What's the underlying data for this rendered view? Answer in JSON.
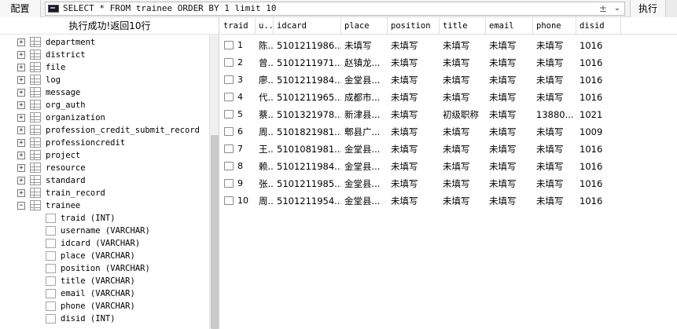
{
  "toolbar": {
    "config_label": "配置",
    "sql": "SELECT * FROM trainee ORDER BY 1 limit 10",
    "plus_minus": "±",
    "dropdown_glyph": "⌄",
    "execute_label": "执行"
  },
  "left_panel": {
    "status": "执行成功!返回10行",
    "tables": [
      {
        "name": "department",
        "expander": "+"
      },
      {
        "name": "district",
        "expander": "+"
      },
      {
        "name": "file",
        "expander": "+"
      },
      {
        "name": "log",
        "expander": "+"
      },
      {
        "name": "message",
        "expander": "+"
      },
      {
        "name": "org_auth",
        "expander": "+"
      },
      {
        "name": "organization",
        "expander": "+"
      },
      {
        "name": "profession_credit_submit_record",
        "expander": "+"
      },
      {
        "name": "professioncredit",
        "expander": "+"
      },
      {
        "name": "project",
        "expander": "+"
      },
      {
        "name": "resource",
        "expander": "+"
      },
      {
        "name": "standard",
        "expander": "+"
      },
      {
        "name": "train_record",
        "expander": "+"
      },
      {
        "name": "trainee",
        "expander": "−"
      }
    ],
    "columns": [
      "traid (INT)",
      "username (VARCHAR)",
      "idcard (VARCHAR)",
      "place (VARCHAR)",
      "position (VARCHAR)",
      "title (VARCHAR)",
      "email (VARCHAR)",
      "phone (VARCHAR)",
      "disid (INT)"
    ]
  },
  "grid": {
    "headers": [
      "traid",
      "u..",
      "idcard",
      "place",
      "position",
      "title",
      "email",
      "phone",
      "disid"
    ],
    "rows": [
      [
        "1",
        "陈..",
        "5101211986...",
        "未填写",
        "未填写",
        "未填写",
        "未填写",
        "未填写",
        "1016"
      ],
      [
        "2",
        "曾..",
        "5101211971...",
        "赵镇龙...",
        "未填写",
        "未填写",
        "未填写",
        "未填写",
        "1016"
      ],
      [
        "3",
        "廖..",
        "5101211984...",
        "金堂县...",
        "未填写",
        "未填写",
        "未填写",
        "未填写",
        "1016"
      ],
      [
        "4",
        "代..",
        "5101211965...",
        "成都市...",
        "未填写",
        "未填写",
        "未填写",
        "未填写",
        "1016"
      ],
      [
        "5",
        "蔡..",
        "5101321978...",
        "新津县...",
        "未填写",
        "初级职称",
        "未填写",
        "13880...",
        "1021"
      ],
      [
        "6",
        "周..",
        "5101821981...",
        "郫县广...",
        "未填写",
        "未填写",
        "未填写",
        "未填写",
        "1009"
      ],
      [
        "7",
        "王..",
        "5101081981...",
        "金堂县...",
        "未填写",
        "未填写",
        "未填写",
        "未填写",
        "1016"
      ],
      [
        "8",
        "赖..",
        "5101211984...",
        "金堂县...",
        "未填写",
        "未填写",
        "未填写",
        "未填写",
        "1016"
      ],
      [
        "9",
        "张..",
        "5101211985...",
        "金堂县...",
        "未填写",
        "未填写",
        "未填写",
        "未填写",
        "1016"
      ],
      [
        "10",
        "周..",
        "5101211954...",
        "金堂县...",
        "未填写",
        "未填写",
        "未填写",
        "未填写",
        "1016"
      ]
    ]
  }
}
